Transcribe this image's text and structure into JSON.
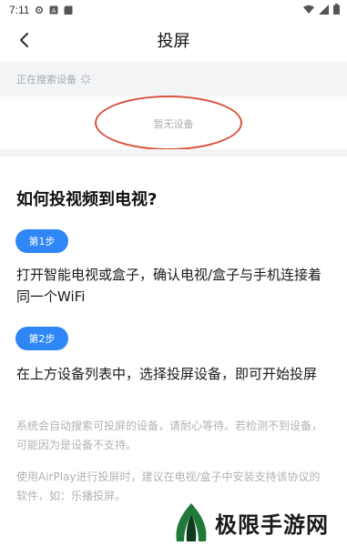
{
  "status_bar": {
    "time": "7:11",
    "icons_left": [
      "settings-icon",
      "sim-a-icon",
      "sd-card-icon"
    ],
    "icons_right": [
      "wifi-icon",
      "signal-icon",
      "battery-icon"
    ]
  },
  "app_bar": {
    "back_icon": "chevron-left-icon",
    "title": "投屏"
  },
  "search": {
    "status": "正在搜索设备",
    "spinner_icon": "loading-spinner-icon",
    "empty_text": "暂无设备",
    "highlight_color": "#d9533a"
  },
  "guide": {
    "title": "如何投视频到电视?",
    "steps": [
      {
        "label": "第1步",
        "text": "打开智能电视或盒子，确认电视/盒子与手机连接着同一个WiFi"
      },
      {
        "label": "第2步",
        "text": "在上方设备列表中，选择投屏设备，即可开始投屏"
      }
    ],
    "notes": [
      "系统会自动搜索可投屏的设备，请耐心等待。若检测不到设备，可能因为是设备不支持。",
      "使用AirPlay进行投屏时，建议在电视/盒子中安装支持该协议的软件，如：乐播投屏。"
    ],
    "accent_color": "#2f86f6"
  },
  "watermark": {
    "text": "极限手游网",
    "logo_icon": "leaf-logo-icon"
  }
}
